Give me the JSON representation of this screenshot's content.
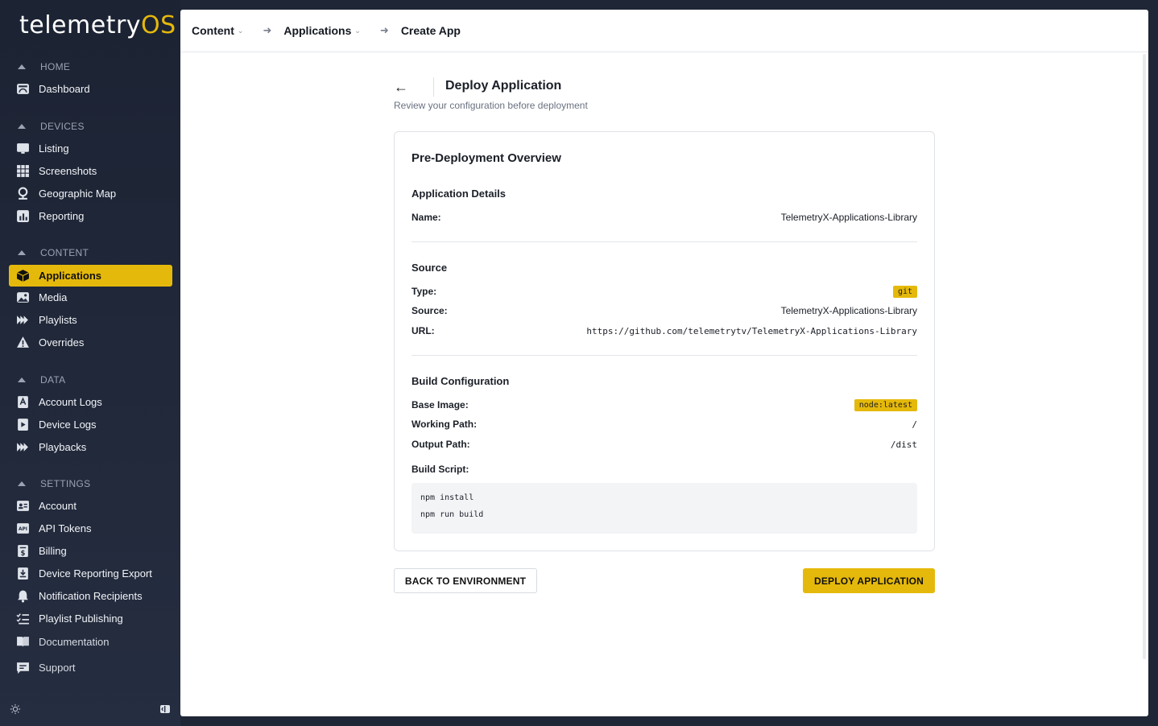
{
  "logo": {
    "part1": "telemetry",
    "part2": "OS"
  },
  "sidebar": {
    "sections": [
      {
        "label": "HOME",
        "items": [
          {
            "label": "Dashboard",
            "icon": "dashboard-icon"
          }
        ]
      },
      {
        "label": "DEVICES",
        "items": [
          {
            "label": "Listing",
            "icon": "monitor-icon"
          },
          {
            "label": "Screenshots",
            "icon": "grid-icon"
          },
          {
            "label": "Geographic Map",
            "icon": "map-pin-icon"
          },
          {
            "label": "Reporting",
            "icon": "bar-chart-icon"
          }
        ]
      },
      {
        "label": "CONTENT",
        "items": [
          {
            "label": "Applications",
            "icon": "cube-icon",
            "active": true
          },
          {
            "label": "Media",
            "icon": "image-icon"
          },
          {
            "label": "Playlists",
            "icon": "playlist-icon"
          },
          {
            "label": "Overrides",
            "icon": "warning-icon"
          }
        ]
      },
      {
        "label": "DATA",
        "items": [
          {
            "label": "Account Logs",
            "icon": "account-log-icon"
          },
          {
            "label": "Device Logs",
            "icon": "device-log-icon"
          },
          {
            "label": "Playbacks",
            "icon": "playback-icon"
          }
        ]
      },
      {
        "label": "SETTINGS",
        "items": [
          {
            "label": "Account",
            "icon": "id-card-icon"
          },
          {
            "label": "API Tokens",
            "icon": "api-icon"
          },
          {
            "label": "Billing",
            "icon": "billing-icon"
          },
          {
            "label": "Device Reporting Export",
            "icon": "download-icon"
          },
          {
            "label": "Notification Recipients",
            "icon": "bell-icon"
          },
          {
            "label": "Playlist Publishing",
            "icon": "list-check-icon"
          }
        ]
      }
    ],
    "footer_items": [
      {
        "label": "Documentation",
        "icon": "book-icon"
      },
      {
        "label": "Support",
        "icon": "chat-icon"
      }
    ]
  },
  "breadcrumb": {
    "item1": "Content",
    "item2": "Applications",
    "item3": "Create App"
  },
  "page": {
    "title": "Deploy Application",
    "subtitle": "Review your configuration before deployment",
    "back_symbol": "←"
  },
  "overview": {
    "title": "Pre-Deployment Overview",
    "app_details": {
      "title": "Application Details",
      "name_label": "Name:",
      "name_value": "TelemetryX-Applications-Library"
    },
    "source": {
      "title": "Source",
      "type_label": "Type:",
      "type_value": "git",
      "source_label": "Source:",
      "source_value": "TelemetryX-Applications-Library",
      "url_label": "URL:",
      "url_value": "https://github.com/telemetrytv/TelemetryX-Applications-Library"
    },
    "build": {
      "title": "Build Configuration",
      "base_image_label": "Base Image:",
      "base_image_value": "node:latest",
      "working_path_label": "Working Path:",
      "working_path_value": "/",
      "output_path_label": "Output Path:",
      "output_path_value": "/dist",
      "script_label": "Build Script:",
      "script_lines": [
        "npm install",
        "npm run build"
      ]
    }
  },
  "actions": {
    "back": "BACK TO ENVIRONMENT",
    "deploy": "DEPLOY APPLICATION"
  },
  "colors": {
    "accent": "#e5b90b",
    "sidebar_bg": "#1c2333"
  }
}
